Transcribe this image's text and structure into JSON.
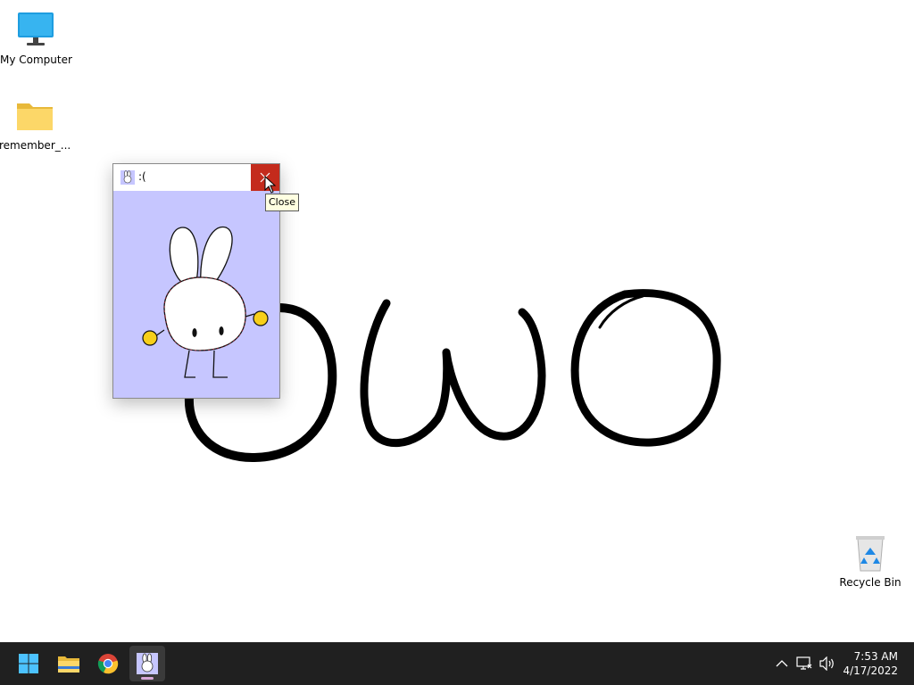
{
  "desktop": {
    "drawing_text": "owo",
    "icons": [
      {
        "label": "My Computer",
        "icon": "monitor-icon"
      },
      {
        "label": "remember_...",
        "icon": "folder-icon"
      },
      {
        "label": "Recycle Bin",
        "icon": "recycle-bin-icon"
      }
    ]
  },
  "popup": {
    "title": ":(",
    "app_icon": "bunny-icon",
    "close_tooltip": "Close",
    "content_background": "#c6c6ff"
  },
  "taskbar": {
    "apps": [
      {
        "name": "Start",
        "icon": "windows-start-icon"
      },
      {
        "name": "File Explorer",
        "icon": "folder-icon"
      },
      {
        "name": "Google Chrome",
        "icon": "chrome-icon"
      },
      {
        "name": ":(",
        "icon": "bunny-icon",
        "active": true
      }
    ],
    "tray_icons": [
      "chevron-up-icon",
      "network-icon",
      "volume-icon"
    ],
    "time": "7:53 AM",
    "date": "4/17/2022"
  },
  "colors": {
    "taskbar": "#202020",
    "close_button": "#c42b1c",
    "tooltip_bg": "#ffffe1"
  }
}
